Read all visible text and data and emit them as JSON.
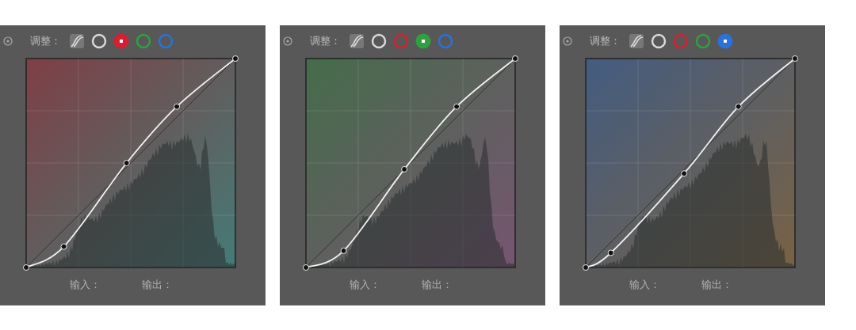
{
  "panels": [
    {
      "label": "调整：",
      "channels": [
        {
          "color": "#d8d8d8",
          "selected": false
        },
        {
          "color": "#d42030",
          "selected": true
        },
        {
          "color": "#30a040",
          "selected": false
        },
        {
          "color": "#2a72d8",
          "selected": false
        }
      ],
      "input_label": "输入：",
      "output_label": "输出："
    },
    {
      "label": "调整：",
      "channels": [
        {
          "color": "#d8d8d8",
          "selected": false
        },
        {
          "color": "#d42030",
          "selected": false
        },
        {
          "color": "#30a040",
          "selected": true
        },
        {
          "color": "#2a72d8",
          "selected": false
        }
      ],
      "input_label": "输入：",
      "output_label": "输出："
    },
    {
      "label": "调整：",
      "channels": [
        {
          "color": "#d8d8d8",
          "selected": false
        },
        {
          "color": "#d42030",
          "selected": false
        },
        {
          "color": "#30a040",
          "selected": false
        },
        {
          "color": "#2a72d8",
          "selected": true
        }
      ],
      "input_label": "输入：",
      "output_label": "输出："
    }
  ]
}
